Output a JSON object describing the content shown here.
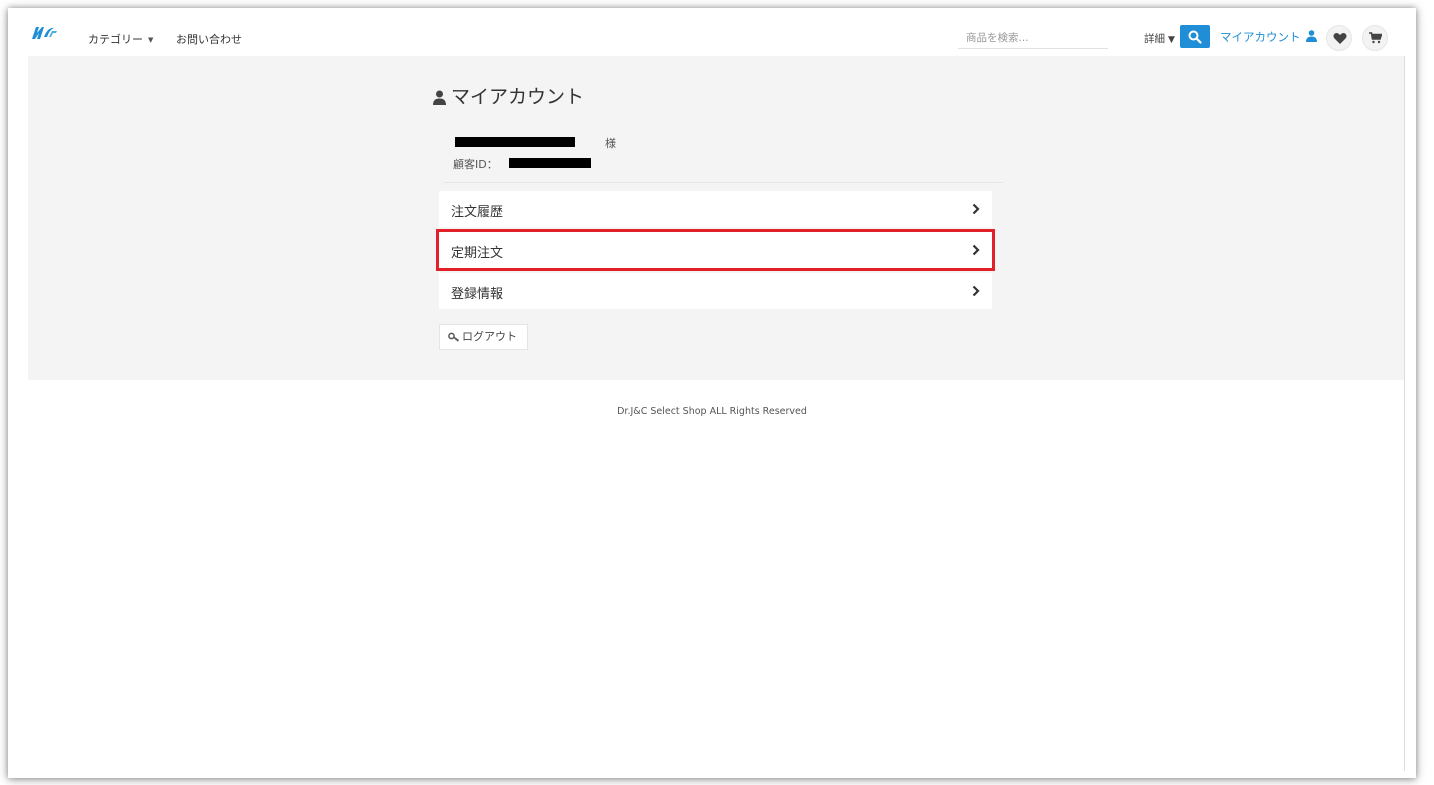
{
  "topnav": {
    "category_label": "カテゴリー",
    "contact_label": "お問い合わせ",
    "search_placeholder": "商品を検索...",
    "detail_label": "詳細",
    "account_label": "マイアカウント"
  },
  "main": {
    "title": "マイアカウント",
    "honorific": "様",
    "customer_id_label": "顧客ID：",
    "menu": [
      {
        "label": "注文履歴"
      },
      {
        "label": "定期注文"
      },
      {
        "label": "登録情報"
      }
    ],
    "logout_label": "ログアウト"
  },
  "footer": {
    "copyright": "Dr.J&C Select Shop ALL Rights Reserved"
  },
  "colors": {
    "accent": "#1f8ed6",
    "highlight": "#e2202a",
    "section_bg": "#f4f4f5"
  },
  "icons": [
    "logo-icon",
    "search-icon",
    "person-icon",
    "heart-icon",
    "cart-icon",
    "chevron-right-icon",
    "key-icon",
    "caret-down-icon"
  ]
}
